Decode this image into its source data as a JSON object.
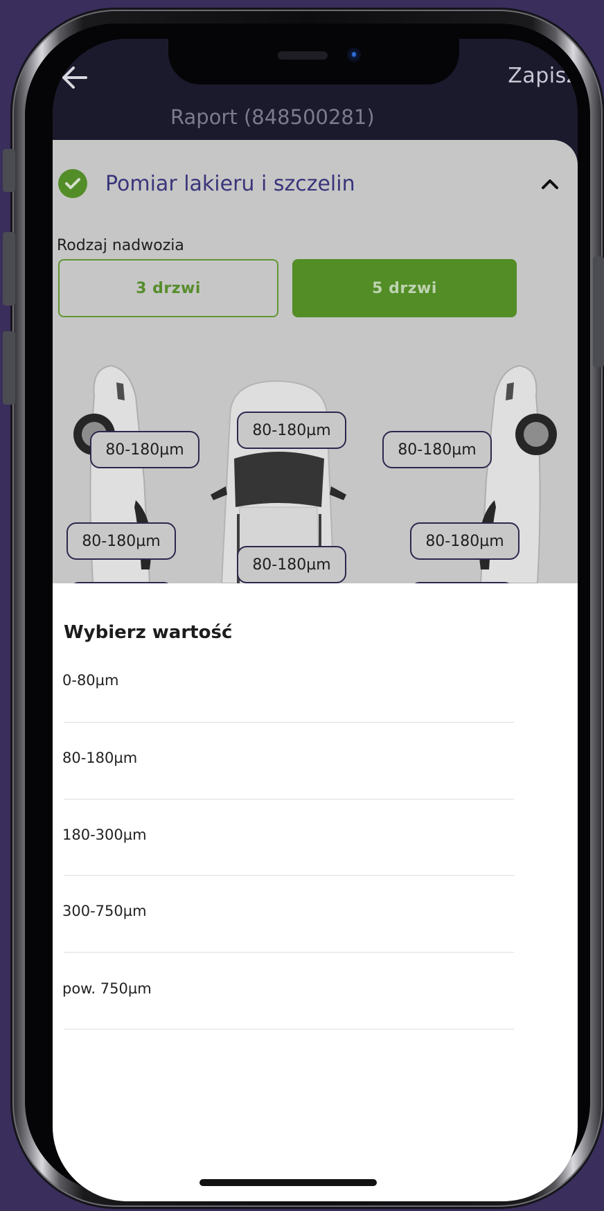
{
  "header": {
    "title": "Raport (848500281)",
    "save_label": "Zapisz"
  },
  "section": {
    "title": "Pomiar lakieru i szczelin",
    "body_type_label": "Rodzaj nadwozia",
    "options": [
      {
        "label": "3 drzwi",
        "selected": false
      },
      {
        "label": "5 drzwi",
        "selected": true
      }
    ]
  },
  "measurements": [
    "80-180µm",
    "80-180µm",
    "80-180µm",
    "80-180µm",
    "80-180µm",
    "80-180µm"
  ],
  "picker": {
    "title": "Wybierz wartość",
    "options": [
      "0-80µm",
      "80-180µm",
      "180-300µm",
      "300-750µm",
      "pow. 750µm"
    ]
  },
  "colors": {
    "accent_green": "#5a9a2a",
    "accent_purple": "#3e3a86",
    "frame_background": "#3a2e5c"
  }
}
